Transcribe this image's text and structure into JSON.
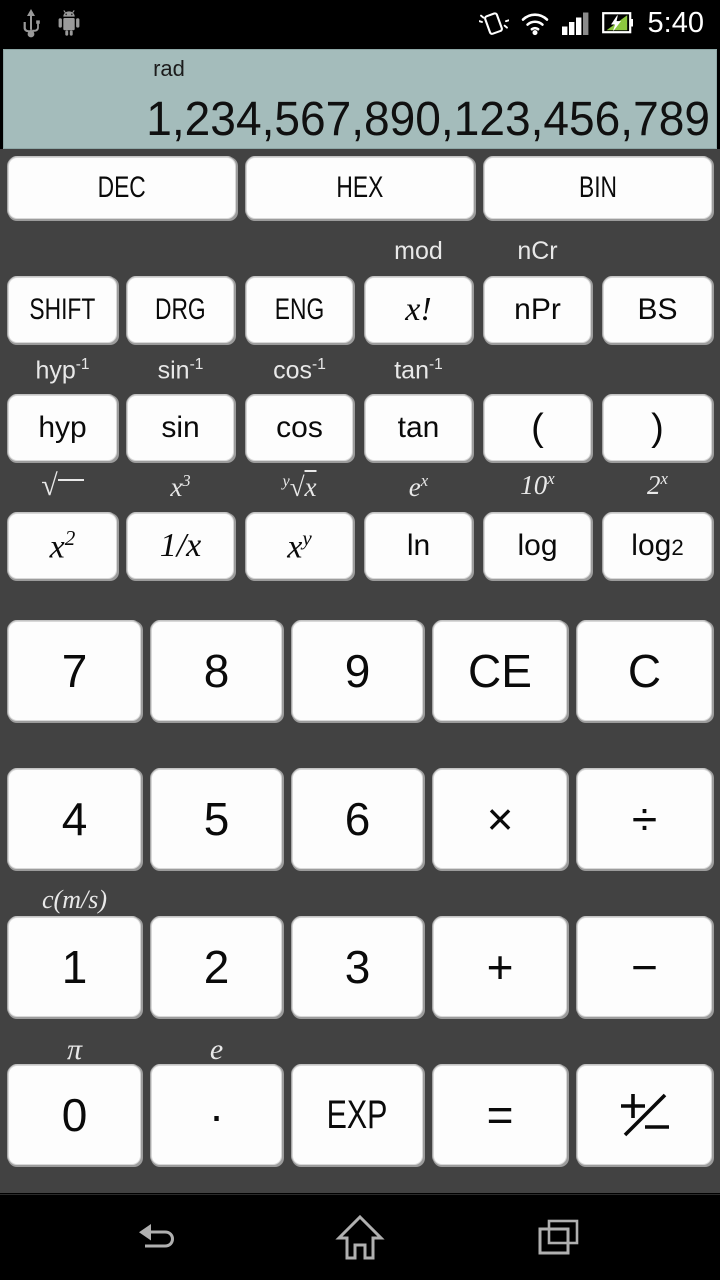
{
  "status_bar": {
    "time": "5:40",
    "left_icons": [
      "usb-icon",
      "android-icon"
    ],
    "right_icons": [
      "vibrate-icon",
      "wifi-icon",
      "signal-icon",
      "battery-charging-icon"
    ],
    "signal_bars_filled": 3,
    "signal_bars_total": 4,
    "battery_color": "#8cc63f"
  },
  "display": {
    "angle_mode": "rad",
    "value": "1,234,567,890,123,456,789",
    "background_color": "#a4bcbb",
    "text_color": "#101010"
  },
  "mode_row": {
    "keys": [
      {
        "label": "DEC",
        "name": "dec-button"
      },
      {
        "label": "HEX",
        "name": "hex-button"
      },
      {
        "label": "BIN",
        "name": "bin-button"
      }
    ]
  },
  "function_rows": [
    {
      "id": "row-shift",
      "keys": [
        {
          "label": "SHIFT",
          "shift": "",
          "style": "cond"
        },
        {
          "label": "DRG",
          "shift": "",
          "style": "cond"
        },
        {
          "label": "ENG",
          "shift": "",
          "style": "cond"
        },
        {
          "label": "x!",
          "shift": "mod",
          "style": "ital"
        },
        {
          "label": "nPr",
          "shift": "nCr",
          "style": "cond"
        },
        {
          "label": "BS",
          "shift": "",
          "style": "cond"
        }
      ]
    },
    {
      "id": "row-trig",
      "keys": [
        {
          "label": "hyp",
          "shift": "hyp-1",
          "style": "plain"
        },
        {
          "label": "sin",
          "shift": "sin-1",
          "style": "plain"
        },
        {
          "label": "cos",
          "shift": "cos-1",
          "style": "plain"
        },
        {
          "label": "tan",
          "shift": "tan-1",
          "style": "plain"
        },
        {
          "label": "(",
          "shift": "",
          "style": "plain"
        },
        {
          "label": ")",
          "shift": "",
          "style": "plain"
        }
      ]
    },
    {
      "id": "row-power",
      "keys": [
        {
          "label": "x2",
          "shift": "sqrt",
          "style": "ital"
        },
        {
          "label": "1/x",
          "shift": "x3",
          "style": "ital"
        },
        {
          "label": "xy",
          "shift": "yrtx",
          "style": "ital"
        },
        {
          "label": "ln",
          "shift": "ex",
          "style": "plain"
        },
        {
          "label": "log",
          "shift": "10x",
          "style": "plain"
        },
        {
          "label": "log2",
          "shift": "2x",
          "style": "plain"
        }
      ]
    }
  ],
  "keypad_rows": [
    {
      "id": "row-789",
      "keys": [
        {
          "label": "7",
          "shift": ""
        },
        {
          "label": "8",
          "shift": ""
        },
        {
          "label": "9",
          "shift": ""
        },
        {
          "label": "CE",
          "shift": ""
        },
        {
          "label": "C",
          "shift": ""
        }
      ]
    },
    {
      "id": "row-456",
      "keys": [
        {
          "label": "4",
          "shift": ""
        },
        {
          "label": "5",
          "shift": ""
        },
        {
          "label": "6",
          "shift": ""
        },
        {
          "label": "×",
          "shift": ""
        },
        {
          "label": "÷",
          "shift": ""
        }
      ]
    },
    {
      "id": "row-123",
      "keys": [
        {
          "label": "1",
          "shift": "c(m/s)"
        },
        {
          "label": "2",
          "shift": ""
        },
        {
          "label": "3",
          "shift": ""
        },
        {
          "label": "+",
          "shift": ""
        },
        {
          "label": "−",
          "shift": ""
        }
      ]
    },
    {
      "id": "row-0",
      "keys": [
        {
          "label": "0",
          "shift": "π"
        },
        {
          "label": "·",
          "shift": "e"
        },
        {
          "label": "EXP",
          "shift": ""
        },
        {
          "label": "=",
          "shift": ""
        },
        {
          "label": "±",
          "shift": ""
        }
      ]
    }
  ],
  "nav_bar": {
    "buttons": [
      {
        "name": "nav-back-button",
        "icon": "back-arrow-icon"
      },
      {
        "name": "nav-home-button",
        "icon": "home-icon"
      },
      {
        "name": "nav-recents-button",
        "icon": "recents-icon"
      }
    ]
  },
  "theme": {
    "body_background": "#424242",
    "key_background": "#fdfdfd",
    "key_text": "#0a0a0a",
    "shift_label_color": "#e8e8e8",
    "status_bar_background": "#000000"
  }
}
